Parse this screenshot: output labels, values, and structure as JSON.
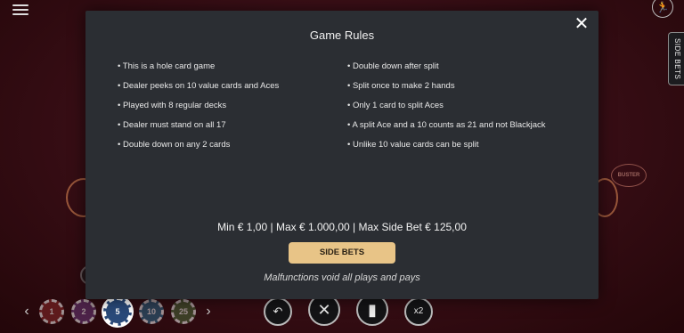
{
  "background": {
    "side_tab_label": "SIDE BETS",
    "buster_label": "BUSTER",
    "chips": [
      "1",
      "2",
      "5",
      "10",
      "25"
    ],
    "controls": [
      "↶",
      "✕",
      "▮",
      "x2"
    ]
  },
  "modal": {
    "title": "Game Rules",
    "close_label": "✕",
    "rules_left": [
      "This is a hole card game",
      "Dealer peeks on 10 value cards and Aces",
      "Played with 8 regular decks",
      "Dealer must stand on all 17",
      "Double down on any 2 cards"
    ],
    "rules_right": [
      "Double down after split",
      "Split once to make 2 hands",
      "Only 1 card to split Aces",
      "A split Ace and a 10 counts as 21 and not Blackjack",
      "Unlike 10 value cards can be split"
    ],
    "limits": "Min € 1,00 | Max € 1.000,00 | Max Side Bet € 125,00",
    "side_bets_button": "SIDE BETS",
    "malfunction_notice": "Malfunctions void all plays and pays"
  },
  "colors": {
    "modal_bg": "#2b2e33",
    "button_gold": "#e8c487"
  }
}
